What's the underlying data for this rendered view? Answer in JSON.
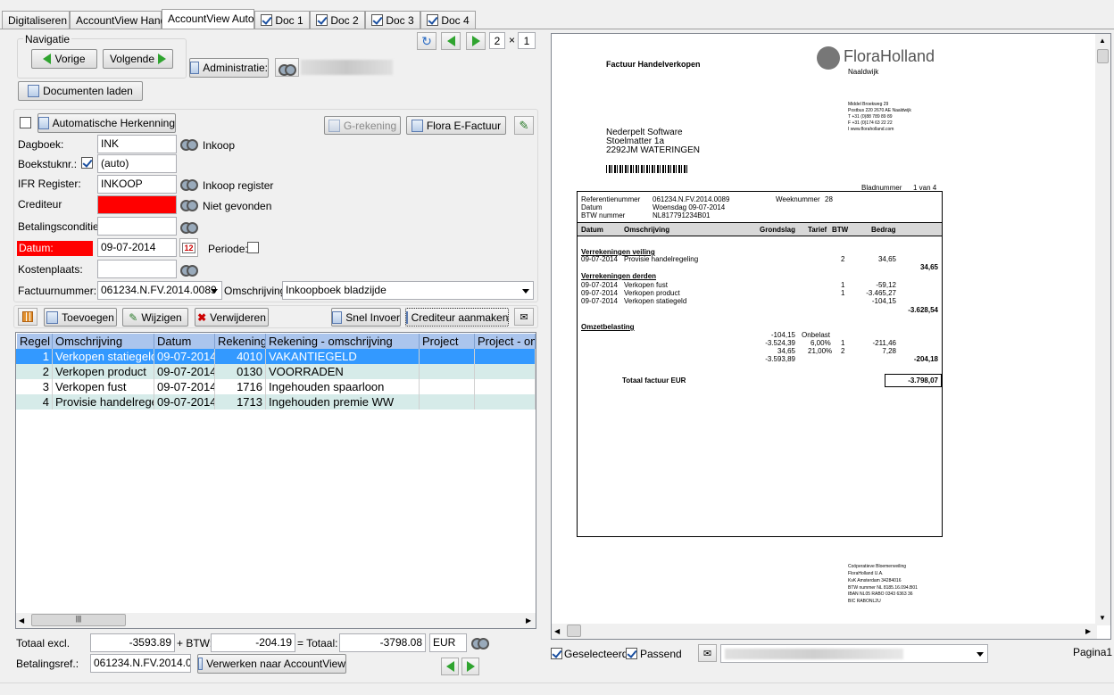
{
  "tabs": [
    "Digitaliseren",
    "AccountView Hand",
    "AccountView Auto",
    "Doc 1",
    "Doc 2",
    "Doc 3",
    "Doc 4"
  ],
  "nav": {
    "title": "Navigatie",
    "prev": "Vorige",
    "next": "Volgende",
    "administratie": "Administratie:",
    "page_current": "2",
    "page_sep": "×",
    "page_total": "1"
  },
  "docs_laden": "Documenten laden",
  "auto": {
    "label": "Automatische Herkenning",
    "grekening": "G-rekening",
    "flora": "Flora E-Factuur"
  },
  "form": {
    "dagboek_label": "Dagboek:",
    "dagboek_value": "INK",
    "dagboek_desc": "Inkoop",
    "boekstuk_label": "Boekstuknr.:",
    "boekstuk_value": "(auto)",
    "ifr_label": "IFR Register:",
    "ifr_value": "INKOOP",
    "ifr_desc": "Inkoop register",
    "crediteur_label": "Crediteur",
    "crediteur_value": "",
    "crediteur_desc": "Niet gevonden",
    "betaling_label": "Betalingsconditie:",
    "betaling_value": "",
    "datum_label": "Datum:",
    "datum_value": "09-07-2014",
    "periode_label": "Periode:",
    "kosten_label": "Kostenplaats:",
    "kosten_value": "",
    "factuur_label": "Factuurnummer:",
    "factuur_value": "061234.N.FV.2014.0089",
    "omschr_label": "Omschrijving:",
    "omschr_value": "Inkoopboek bladzijde"
  },
  "toolbar": {
    "toevoegen": "Toevoegen",
    "wijzigen": "Wijzigen",
    "verwijderen": "Verwijderen",
    "snel": "Snel Invoer",
    "crediteur": "Crediteur aanmaken"
  },
  "grid": {
    "headers": [
      "Regel",
      "Omschrijving",
      "Datum",
      "Rekening",
      "Rekening - omschrijving",
      "Project",
      "Project - om"
    ],
    "rows": [
      [
        "1",
        "Verkopen statiegeld",
        "09-07-2014",
        "4010",
        "VAKANTIEGELD",
        "",
        ""
      ],
      [
        "2",
        "Verkopen product",
        "09-07-2014",
        "0130",
        "VOORRADEN",
        "",
        ""
      ],
      [
        "3",
        "Verkopen fust",
        "09-07-2014",
        "1716",
        "Ingehouden spaarloon",
        "",
        ""
      ],
      [
        "4",
        "Provisie handelregeling",
        "09-07-2014",
        "1713",
        "Ingehouden premie WW",
        "",
        ""
      ]
    ]
  },
  "totals": {
    "excl_label": "Totaal excl.",
    "excl": "-3593.89",
    "btw_label": "+ BTW:",
    "btw": "-204.19",
    "tot_label": "= Totaal:",
    "tot": "-3798.08",
    "currency": "EUR",
    "ref_label": "Betalingsref.:",
    "ref": "061234.N.FV.2014.0089",
    "verwerken": "Verwerken naar AccountView"
  },
  "doc": {
    "title": "Factuur Handelverkopen",
    "logo1": "Flora",
    "logo2": "Holland",
    "logo_sub": "Naaldwijk",
    "addr": [
      "Middel Broekweg 29",
      "Postbus 220  2670 AE Naaldwijk",
      "T +31 (0)88 789 89 89",
      "F +31 (0)174 63 22 22",
      "I www.floraholland.com"
    ],
    "to": [
      "Nederpelt Software",
      "Stoelmatter 1a",
      "2292JM WATERINGEN"
    ],
    "barcode": "๑๑๑๑",
    "blad_label": "Bladnummer",
    "blad": "1  van  4",
    "ref_label": "Referentienummer",
    "ref": "061234.N.FV.2014.0089",
    "week_label": "Weeknummer",
    "week": "28",
    "datum_label": "Datum",
    "datum": "Woensdag 09-07-2014",
    "btw_label": "BTW nummer",
    "btw": "NL817791234B01",
    "cols": [
      "Datum",
      "Omschrijving",
      "Grondslag",
      "Tarief",
      "BTW",
      "Bedrag"
    ],
    "sec1": "Verrekeningen veiling",
    "sec1_row": [
      "09-07-2014",
      "Provisie handelregeling",
      "2",
      "34,65"
    ],
    "sec1_sum": "34,65",
    "sec2": "Verrekeningen derden",
    "sec2_rows": [
      [
        "09-07-2014",
        "Verkopen fust",
        "1",
        "-59,12"
      ],
      [
        "09-07-2014",
        "Verkopen product",
        "1",
        "-3.465,27"
      ],
      [
        "09-07-2014",
        "Verkopen statiegeld",
        "",
        "-104,15"
      ]
    ],
    "sec2_sum": "-3.628,54",
    "sec3": "Omzetbelasting",
    "sec3_rows": [
      [
        "-104,15",
        "Onbelast",
        "",
        ""
      ],
      [
        "-3.524,39",
        "6,00%",
        "1",
        "-211,46"
      ],
      [
        "34,65",
        "21,00%",
        "2",
        "7,28"
      ],
      [
        "-3.593,89",
        "",
        "",
        ""
      ]
    ],
    "sec3_sum": "-204,18",
    "total_label": "Totaal factuur EUR",
    "total": "-3.798,07",
    "footer": [
      "Coöperatieve Bloemenveiling",
      "FloraHolland U.A.",
      "KvK Amsterdam 34284016",
      "BTW nummer NL 8185.16.094.B01",
      "IBAN NL05 RABO 0343 6363 36",
      "BIC RABONL2U"
    ]
  },
  "bottom": {
    "geselecteerd": "Geselecteerd",
    "passend": "Passend",
    "pagina": "Pagina1"
  }
}
